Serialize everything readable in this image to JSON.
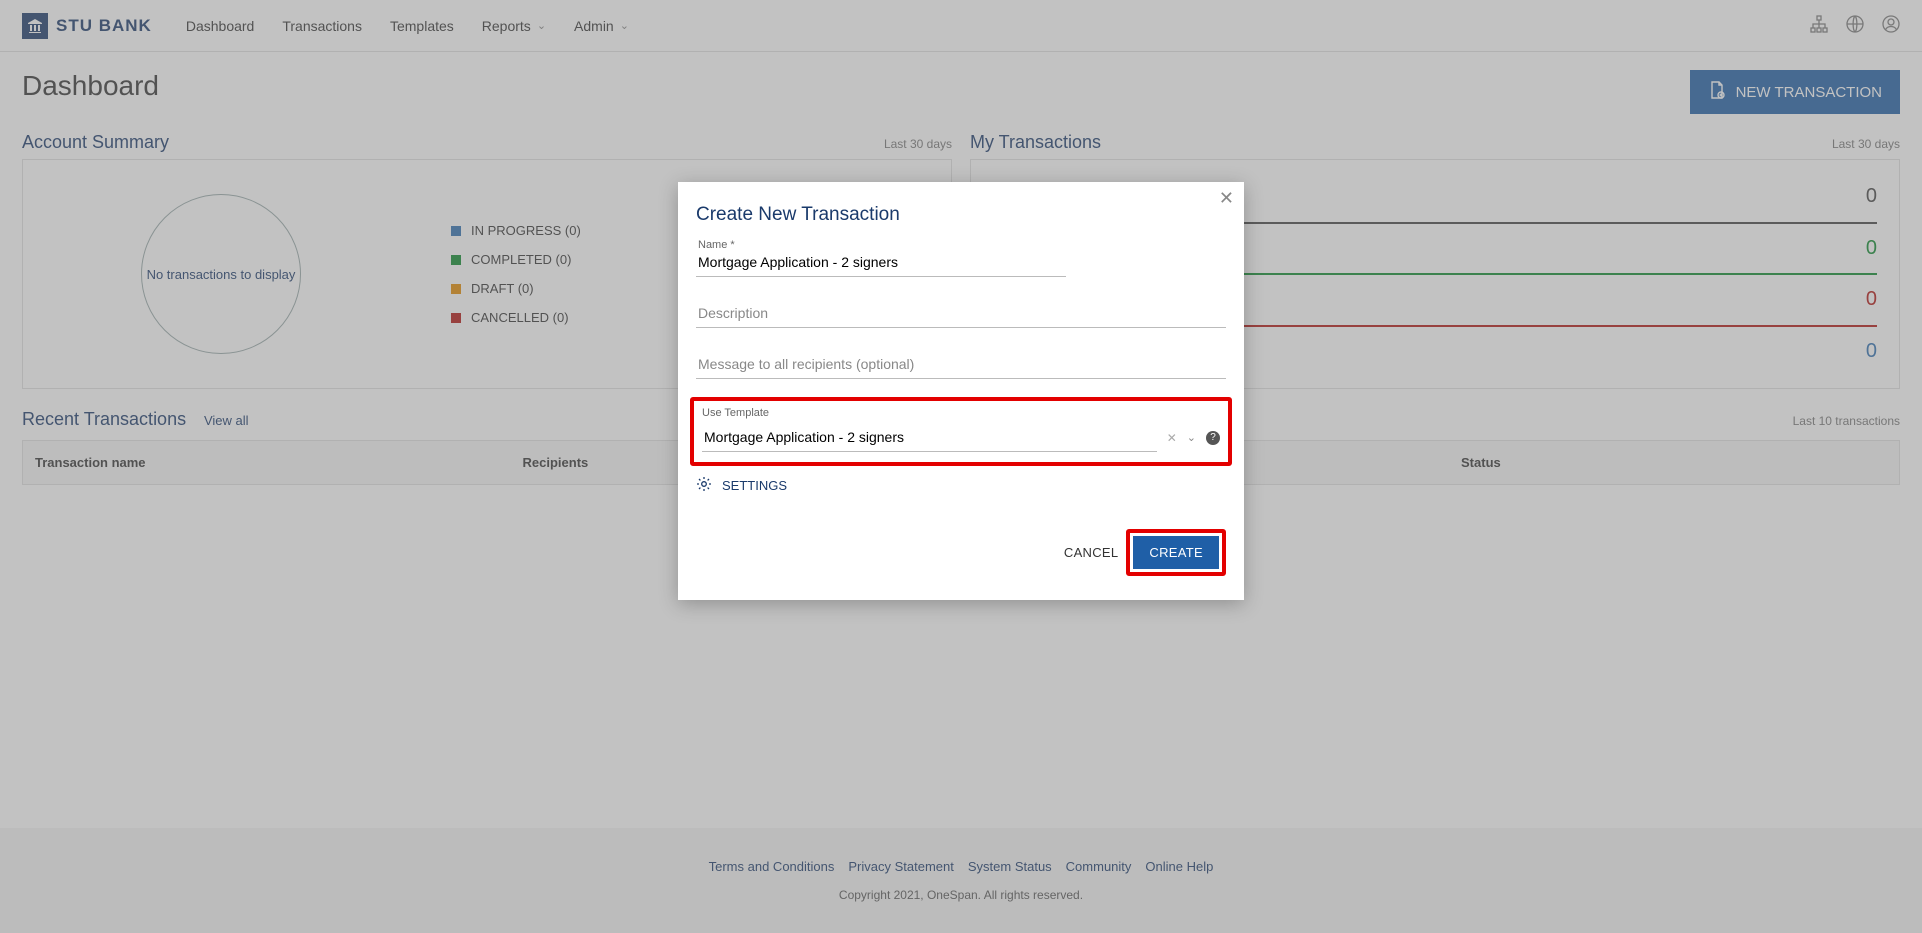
{
  "brand": {
    "name": "STU BANK"
  },
  "nav": {
    "dashboard": "Dashboard",
    "transactions": "Transactions",
    "templates": "Templates",
    "reports": "Reports",
    "admin": "Admin"
  },
  "page": {
    "title": "Dashboard",
    "new_transaction": "NEW TRANSACTION"
  },
  "account_summary": {
    "title": "Account Summary",
    "range": "Last 30 days",
    "empty": "No transactions to display",
    "legend": {
      "in_progress": "IN PROGRESS (0)",
      "completed": "COMPLETED (0)",
      "draft": "DRAFT (0)",
      "cancelled": "CANCELLED (0)"
    }
  },
  "my_transactions": {
    "title": "My Transactions",
    "range": "Last 30 days",
    "rows": {
      "a": "0",
      "b": "0",
      "c": "0",
      "d": "0"
    }
  },
  "recent": {
    "title": "Recent Transactions",
    "view_all": "View all",
    "range": "Last 10 transactions",
    "columns": {
      "name": "Transaction name",
      "recipients": "Recipients",
      "status": "Status"
    }
  },
  "footer": {
    "terms": "Terms and Conditions",
    "privacy": "Privacy Statement",
    "system_status": "System Status",
    "community": "Community",
    "help": "Online Help",
    "copyright": "Copyright 2021, OneSpan. All rights reserved."
  },
  "modal": {
    "title": "Create New Transaction",
    "name_label": "Name *",
    "name_value": "Mortgage Application - 2 signers",
    "description_placeholder": "Description",
    "message_placeholder": "Message to all recipients (optional)",
    "template_label": "Use Template",
    "template_value": "Mortgage Application - 2 signers",
    "settings": "SETTINGS",
    "cancel": "CANCEL",
    "create": "CREATE"
  }
}
